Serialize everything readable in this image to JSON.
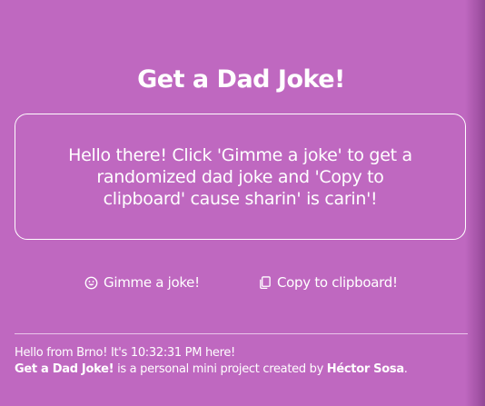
{
  "header": {
    "title": "Get a Dad Joke!"
  },
  "joke": {
    "text": "Hello there! Click 'Gimme a joke' to get a randomized dad joke and 'Copy to clipboard' cause sharin' is carin'!"
  },
  "actions": {
    "joke_label": "Gimme a joke!",
    "joke_icon": "smile-icon",
    "copy_label": "Copy to clipboard!",
    "copy_icon": "copy-icon"
  },
  "footer": {
    "greeting": "Hello from Brno! It's 10:32:31 PM here!",
    "project_name": "Get a Dad Joke!",
    "project_desc": " is a personal mini project created by ",
    "author": "Héctor Sosa",
    "period": "."
  },
  "colors": {
    "background": "#bf68c0",
    "text": "#ffffff"
  }
}
